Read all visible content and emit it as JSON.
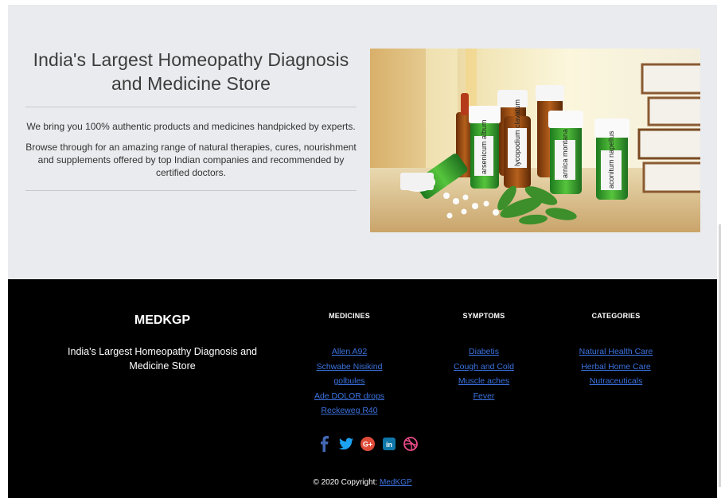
{
  "hero": {
    "title": "India's Largest Homeopathy Diagnosis and Medicine Store",
    "lead": "We bring you 100% authentic products and medicines handpicked by experts.",
    "body": "Browse through for an amazing range of natural therapies, cures, nourishment and supplements offered by top Indian companies and recommended by certified doctors.",
    "image": {
      "bottle_labels": [
        "arsenicum album",
        "lycopodium clavatum",
        "arnica montana",
        "aconitum napellus"
      ]
    }
  },
  "footer": {
    "brand": "MEDKGP",
    "description": "India's Largest Homeopathy Diagnosis and Medicine Store",
    "medicines": {
      "heading": "MEDICINES",
      "links": [
        "Allen A92",
        "Schwabe Nisikind golbules",
        "Ade DOLOR drops",
        "Reckeweg R40"
      ]
    },
    "symptoms": {
      "heading": "SYMPTOMS",
      "links": [
        "Diabetis",
        "Cough and Cold",
        "Muscle aches",
        "Fever"
      ]
    },
    "categories": {
      "heading": "CATEGORIES",
      "links": [
        "Natural Health Care",
        "Herbal Home Care",
        "Nutraceuticals"
      ]
    },
    "social": [
      {
        "icon": "facebook-icon",
        "glyph": "f",
        "color": "#3b5998"
      },
      {
        "icon": "twitter-icon",
        "glyph": "t",
        "color": "#1da1f2"
      },
      {
        "icon": "google-plus-icon",
        "glyph": "G+",
        "color": "#dd4b39"
      },
      {
        "icon": "linkedin-icon",
        "glyph": "in",
        "color": "#0e76a8"
      },
      {
        "icon": "dribbble-icon",
        "glyph": "d",
        "color": "#ea4c89"
      }
    ],
    "copyright": {
      "text": "© 2020 Copyright:",
      "link": "MedKGP"
    }
  },
  "colors": {
    "page_bg": "#e9ebee",
    "footer_bg": "#000000",
    "link": "#3b73e0"
  }
}
